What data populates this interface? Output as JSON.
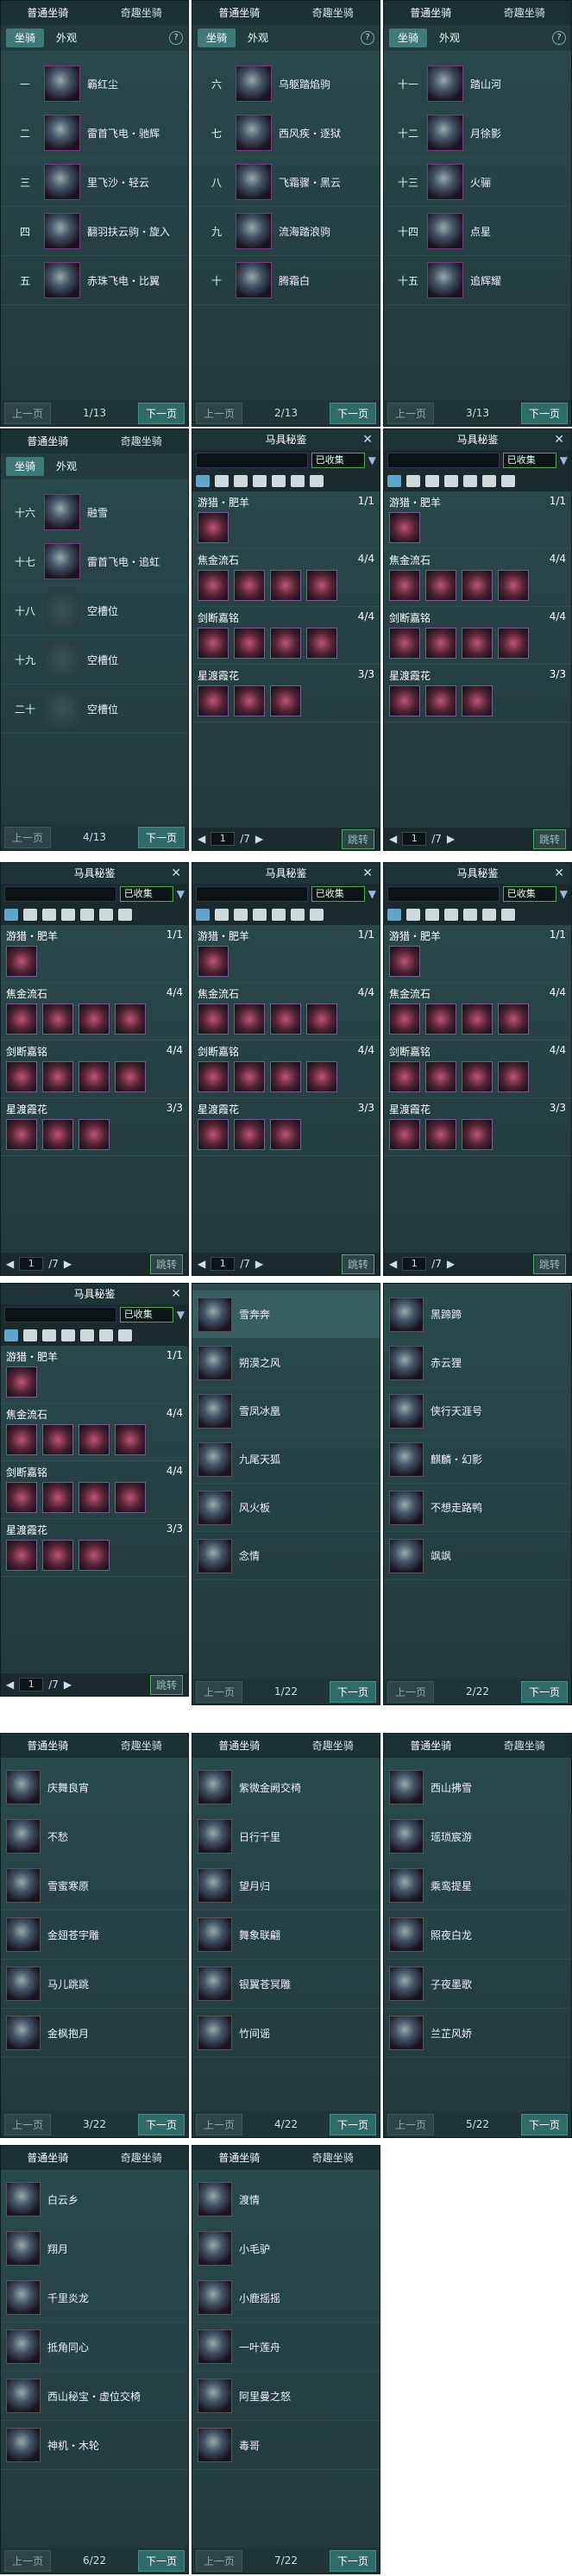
{
  "common": {
    "tab_normal": "普通坐骑",
    "tab_fun": "奇趣坐骑",
    "sub_mount": "坐骑",
    "sub_look": "外观",
    "help": "?",
    "prev": "上一页",
    "next": "下一页",
    "close": "✕",
    "filter": "已收集",
    "jump": "跳转"
  },
  "mount_pages": [
    {
      "page": "1/13",
      "rows": [
        [
          "一",
          "霸红尘"
        ],
        [
          "二",
          "雷首飞电・驰辉"
        ],
        [
          "三",
          "里飞沙・轻云"
        ],
        [
          "四",
          "翻羽扶云驹・旋入"
        ],
        [
          "五",
          "赤珠飞电・比翼"
        ]
      ]
    },
    {
      "page": "2/13",
      "rows": [
        [
          "六",
          "乌躯踏焰驹"
        ],
        [
          "七",
          "西风疾・逐狱"
        ],
        [
          "八",
          "飞霜骤・黑云"
        ],
        [
          "九",
          "流海踏浪驹"
        ],
        [
          "十",
          "腾霜白"
        ]
      ]
    },
    {
      "page": "3/13",
      "rows": [
        [
          "十一",
          "踏山河"
        ],
        [
          "十二",
          "月徐影"
        ],
        [
          "十三",
          "火骊"
        ],
        [
          "十四",
          "点星"
        ],
        [
          "十五",
          "追辉耀"
        ]
      ]
    },
    {
      "page": "4/13",
      "rows": [
        [
          "十六",
          "融雪"
        ],
        [
          "十七",
          "雷首飞电・追虹"
        ],
        [
          "十八",
          "空槽位"
        ],
        [
          "十九",
          "空槽位"
        ],
        [
          "二十",
          "空槽位"
        ]
      ]
    }
  ],
  "saddle": {
    "title": "马具秘鉴",
    "page_input": "1",
    "page_total": "/7",
    "groups": [
      {
        "name": "游猎・肥羊",
        "count": "1/1",
        "n": 1
      },
      {
        "name": "焦金流石",
        "count": "4/4",
        "n": 4
      },
      {
        "name": "剑断嘉铭",
        "count": "4/4",
        "n": 4
      },
      {
        "name": "星渡霞花",
        "count": "3/3",
        "n": 3
      }
    ]
  },
  "fun_pages": [
    {
      "page": "1/22",
      "rows": [
        "雪奔奔",
        "朔漠之风",
        "雪凤冰凰",
        "九尾天狐",
        "风火板",
        "念情"
      ]
    },
    {
      "page": "2/22",
      "rows": [
        "黑蹄蹄",
        "赤云狸",
        "侠行天涯号",
        "麒麟・幻影",
        "不想走路鸭",
        "飒飒"
      ]
    },
    {
      "page": "3/22",
      "rows": [
        "庆舞良宵",
        "不愁",
        "雪蜜寒原",
        "金翅苍宇雕",
        "马儿跳跳",
        "金枫抱月"
      ]
    },
    {
      "page": "4/22",
      "rows": [
        "紫微金阙交椅",
        "日行千里",
        "望月归",
        "舞象联翩",
        "银翼苍冥雕",
        "竹间谣"
      ]
    },
    {
      "page": "5/22",
      "rows": [
        "西山拂雪",
        "瑶琐宸游",
        "乘鸾提星",
        "照夜白龙",
        "子夜墨歌",
        "兰芷风娇"
      ]
    },
    {
      "page": "6/22",
      "rows": [
        "白云乡",
        "翔月",
        "千里炎龙",
        "抵角同心",
        "西山秘宝・虚位交椅",
        "神机・木轮"
      ]
    },
    {
      "page": "7/22",
      "rows": [
        "渡情",
        "小毛驴",
        "小鹿摇摇",
        "一叶莲舟",
        "阿里曼之怒",
        "毒哥"
      ]
    }
  ]
}
